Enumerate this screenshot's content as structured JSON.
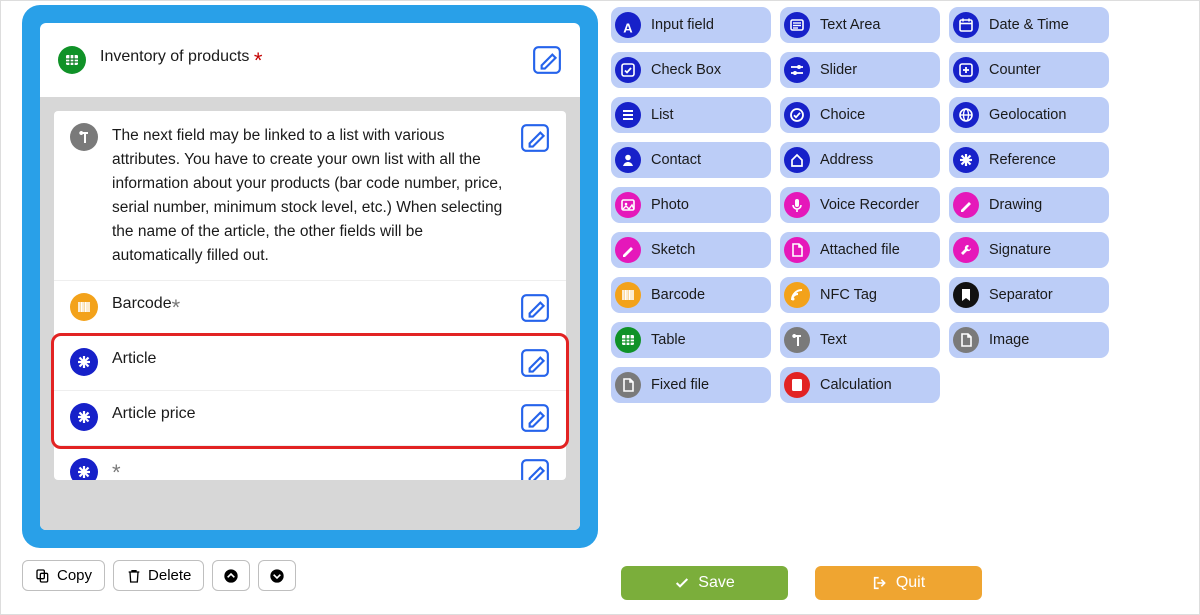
{
  "form": {
    "title": "Inventory of products",
    "title_required": true,
    "fields": [
      {
        "id": "desc",
        "kind": "text",
        "icon": "paragraph-icon",
        "color": "gray",
        "text": "The next field may be linked to a list with various attributes. You have to create your own list with all the information about your products (bar code number, price, serial number, minimum stock level, etc.) When selecting the name of the article, the other fields will be automatically filled out."
      },
      {
        "id": "barcode",
        "kind": "barcode",
        "icon": "barcode-icon",
        "color": "orange",
        "label": "Barcode",
        "flag": "opt"
      },
      {
        "id": "article",
        "kind": "reference",
        "icon": "asterisk-icon",
        "color": "blue",
        "label": "Article"
      },
      {
        "id": "price",
        "kind": "reference",
        "icon": "asterisk-icon",
        "color": "blue",
        "label": "Article price"
      },
      {
        "id": "more",
        "kind": "reference",
        "icon": "asterisk-icon",
        "color": "blue",
        "label": "",
        "flag": "opt"
      }
    ],
    "highlight_field_ids": [
      "article",
      "price"
    ]
  },
  "toolbar": {
    "copy": "Copy",
    "delete": "Delete"
  },
  "palette": [
    {
      "label": "Input field",
      "icon": "letter-a-icon",
      "color": "blue"
    },
    {
      "label": "Text Area",
      "icon": "textarea-icon",
      "color": "blue"
    },
    {
      "label": "Date & Time",
      "icon": "calendar-icon",
      "color": "blue"
    },
    {
      "label": "Check Box",
      "icon": "checkbox-icon",
      "color": "blue"
    },
    {
      "label": "Slider",
      "icon": "slider-icon",
      "color": "blue"
    },
    {
      "label": "Counter",
      "icon": "plus-box-icon",
      "color": "blue"
    },
    {
      "label": "List",
      "icon": "list-icon",
      "color": "blue"
    },
    {
      "label": "Choice",
      "icon": "choice-icon",
      "color": "blue"
    },
    {
      "label": "Geolocation",
      "icon": "globe-icon",
      "color": "blue"
    },
    {
      "label": "Contact",
      "icon": "person-icon",
      "color": "blue"
    },
    {
      "label": "Address",
      "icon": "home-icon",
      "color": "blue"
    },
    {
      "label": "Reference",
      "icon": "asterisk-icon",
      "color": "blue"
    },
    {
      "label": "Photo",
      "icon": "image-icon",
      "color": "magenta"
    },
    {
      "label": "Voice Recorder",
      "icon": "mic-icon",
      "color": "magenta"
    },
    {
      "label": "Drawing",
      "icon": "pencil-icon",
      "color": "magenta"
    },
    {
      "label": "Sketch",
      "icon": "pencil-icon",
      "color": "magenta"
    },
    {
      "label": "Attached file",
      "icon": "file-icon",
      "color": "magenta"
    },
    {
      "label": "Signature",
      "icon": "wrench-icon",
      "color": "magenta"
    },
    {
      "label": "Barcode",
      "icon": "barcode-icon",
      "color": "orange"
    },
    {
      "label": "NFC Tag",
      "icon": "rss-icon",
      "color": "orange"
    },
    {
      "label": "Separator",
      "icon": "bookmark-icon",
      "color": "black"
    },
    {
      "label": "Table",
      "icon": "table-fill-icon",
      "color": "green"
    },
    {
      "label": "Text",
      "icon": "paragraph-icon",
      "color": "gray"
    },
    {
      "label": "Image",
      "icon": "file-icon",
      "color": "grayStroke"
    },
    {
      "label": "Fixed file",
      "icon": "file-icon",
      "color": "gray"
    },
    {
      "label": "Calculation",
      "icon": "calc-icon",
      "color": "red"
    }
  ],
  "buttons": {
    "save": "Save",
    "quit": "Quit"
  }
}
